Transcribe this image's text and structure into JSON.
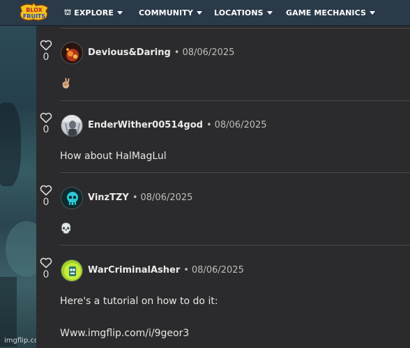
{
  "nav": {
    "explore": "EXPLORE",
    "community": "COMMUNITY",
    "locations": "LOCATIONS",
    "mechanics": "GAME MECHANICS"
  },
  "logo_text": "BLOX FRUITS",
  "watermark": "imgflip.com",
  "comments": [
    {
      "username": "Devious&Daring",
      "date": "08/06/2025",
      "votes": "0",
      "body": "✌🏼",
      "avatar_icon": "fire-avatar-icon"
    },
    {
      "username": "EnderWither00514god",
      "date": "08/06/2025",
      "votes": "0",
      "body": "How about HalMagLul",
      "avatar_icon": "character-avatar-icon"
    },
    {
      "username": "VinzTZY",
      "date": "08/06/2025",
      "votes": "0",
      "body": "💀",
      "avatar_icon": "skull-avatar-icon"
    },
    {
      "username": "WarCriminalAsher",
      "date": "08/06/2025",
      "votes": "0",
      "body": "Here's a tutorial on how to do it:",
      "body2": "Www.imgflip.com/i/9geor3",
      "avatar_icon": "green-creature-avatar-icon"
    }
  ],
  "colors": {
    "background": "#2b2b2d",
    "topbar": "#2a3a49",
    "divider": "#494949"
  }
}
